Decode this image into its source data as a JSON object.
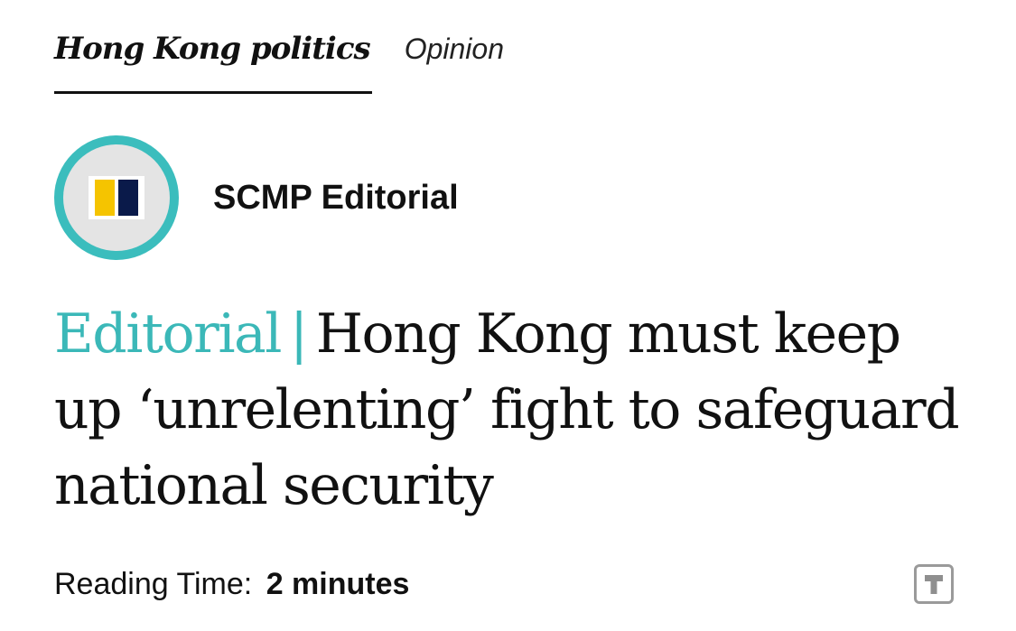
{
  "tabs": [
    {
      "label": "Hong Kong politics",
      "active": true
    },
    {
      "label": "Opinion",
      "active": false
    }
  ],
  "author": {
    "name": "SCMP Editorial",
    "avatar_ring_color": "#3bbdbd",
    "logo_colors": [
      "#f5c400",
      "#0a1a4a"
    ]
  },
  "headline": {
    "kicker": "Editorial",
    "separator": "|",
    "title": "Hong Kong must keep up ‘unrelenting’ fight to safeguard national security"
  },
  "reading_time": {
    "label": "Reading Time:",
    "value": "2 minutes"
  },
  "accent_color": "#3bb8b8",
  "text_size_button": {
    "icon": "text-size-icon"
  }
}
